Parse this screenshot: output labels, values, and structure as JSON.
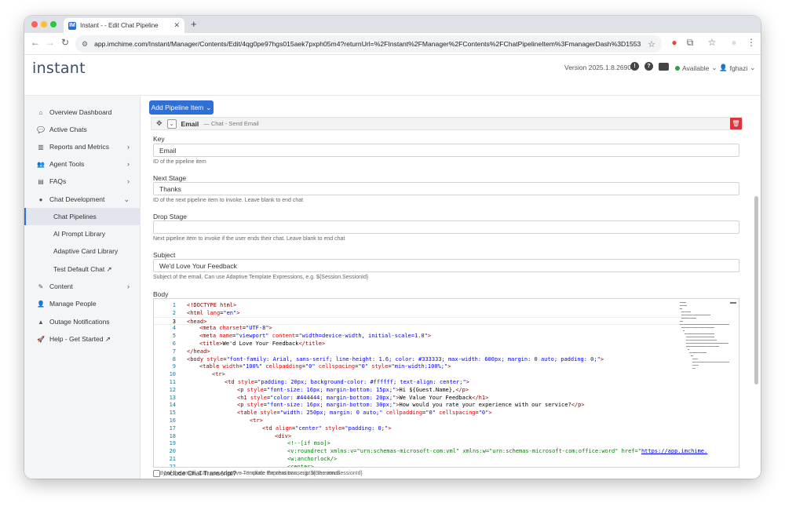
{
  "browser": {
    "tab_title": "Instant - - Edit Chat Pipeline",
    "favicon_text": "IM",
    "url": "app.imchime.com/Instant/Manager/Contents/Edit/4qg0pe97hgs015aek7pxph05m4?returnUrl=%2FInstant%2FManager%2FContents%2FChatPipelineItem%3FmanagerDash%3D1553283004"
  },
  "header": {
    "logo": "instant",
    "version": "Version 2025.1.8.2690",
    "status": "Available",
    "username": "fghazi"
  },
  "sidebar": {
    "items": [
      {
        "label": "Overview Dashboard",
        "icon": "home-icon",
        "glyph": "⌂"
      },
      {
        "label": "Active Chats",
        "icon": "chats-icon",
        "glyph": "💬"
      },
      {
        "label": "Reports and Metrics",
        "icon": "chart-icon",
        "glyph": "▥"
      },
      {
        "label": "Agent Tools",
        "icon": "users-icon",
        "glyph": "👥"
      },
      {
        "label": "FAQs",
        "icon": "book-icon",
        "glyph": "▤"
      },
      {
        "label": "Chat Development",
        "icon": "comment-icon",
        "glyph": "●"
      },
      {
        "label": "Chat Pipelines"
      },
      {
        "label": "AI Prompt Library"
      },
      {
        "label": "Adaptive Card Library"
      },
      {
        "label": "Test Default Chat ↗"
      },
      {
        "label": "Content",
        "icon": "edit-icon",
        "glyph": "✎"
      },
      {
        "label": "Manage People",
        "icon": "person-icon",
        "glyph": "👤"
      },
      {
        "label": "Outage Notifications",
        "icon": "warning-icon",
        "glyph": "▲"
      },
      {
        "label": "Help - Get Started ↗",
        "icon": "rocket-icon",
        "glyph": "🚀"
      }
    ],
    "collapse": "«"
  },
  "main": {
    "add_button": "Add Pipeline Item",
    "item_title": "Email",
    "item_subtitle": "— Chat - Send Email",
    "fields": {
      "key": {
        "label": "Key",
        "value": "Email",
        "help": "ID of the pipeline item"
      },
      "next_stage": {
        "label": "Next Stage",
        "value": "Thanks",
        "help": "ID of the next pipeline item to invoke. Leave blank to end chat"
      },
      "drop_stage": {
        "label": "Drop Stage",
        "value": "",
        "help": "Next pipeline item to invoke if the user ends their chat. Leave blank to end chat"
      },
      "subject": {
        "label": "Subject",
        "value": "We'd Love Your Feedback",
        "help": "Subject of the email. Can use Adaptive Template Expressions, e.g. ${Session.SessionId}"
      },
      "body": {
        "label": "Body",
        "help": "Body of the email. Can use Adaptive Template Expressions, e.g. ${Session.SessionId}"
      }
    },
    "code_lines": [
      {
        "n": "1",
        "indent": 0,
        "segs": [
          [
            "t",
            "<!DOCTYPE html>"
          ]
        ]
      },
      {
        "n": "2",
        "indent": 0,
        "segs": [
          [
            "t",
            "<html "
          ],
          [
            "a",
            "lang"
          ],
          [
            "x",
            "="
          ],
          [
            "v",
            "\"en\""
          ],
          [
            "t",
            ">"
          ]
        ]
      },
      {
        "n": "3",
        "indent": 0,
        "segs": [
          [
            "t",
            "<head>"
          ]
        ]
      },
      {
        "n": "4",
        "indent": 1,
        "segs": [
          [
            "t",
            "<meta "
          ],
          [
            "a",
            "charset"
          ],
          [
            "x",
            "="
          ],
          [
            "v",
            "\"UTF-8\""
          ],
          [
            "t",
            ">"
          ]
        ]
      },
      {
        "n": "5",
        "indent": 1,
        "segs": [
          [
            "t",
            "<meta "
          ],
          [
            "a",
            "name"
          ],
          [
            "x",
            "="
          ],
          [
            "v",
            "\"viewport\""
          ],
          [
            "x",
            " "
          ],
          [
            "a",
            "content"
          ],
          [
            "x",
            "="
          ],
          [
            "v",
            "\"width=device-width, initial-scale=1.0\""
          ],
          [
            "t",
            ">"
          ]
        ]
      },
      {
        "n": "6",
        "indent": 1,
        "segs": [
          [
            "t",
            "<title>"
          ],
          [
            "x",
            "We'd Love Your Feedback"
          ],
          [
            "t",
            "</title>"
          ]
        ]
      },
      {
        "n": "7",
        "indent": 0,
        "segs": [
          [
            "t",
            "</head>"
          ]
        ]
      },
      {
        "n": "8",
        "indent": 0,
        "segs": [
          [
            "t",
            "<body "
          ],
          [
            "a",
            "style"
          ],
          [
            "x",
            "="
          ],
          [
            "v",
            "\"font-family: Arial, sans-serif; line-height: 1.6; color: #333333; max-width: 600px; margin: 0 auto; padding: 0;\""
          ],
          [
            "t",
            ">"
          ]
        ]
      },
      {
        "n": "9",
        "indent": 1,
        "segs": [
          [
            "t",
            "<table "
          ],
          [
            "a",
            "width"
          ],
          [
            "x",
            "="
          ],
          [
            "v",
            "\"100%\""
          ],
          [
            "x",
            " "
          ],
          [
            "a",
            "cellpadding"
          ],
          [
            "x",
            "="
          ],
          [
            "v",
            "\"0\""
          ],
          [
            "x",
            " "
          ],
          [
            "a",
            "cellspacing"
          ],
          [
            "x",
            "="
          ],
          [
            "v",
            "\"0\""
          ],
          [
            "x",
            " "
          ],
          [
            "a",
            "style"
          ],
          [
            "x",
            "="
          ],
          [
            "v",
            "\"min-width:100%;\""
          ],
          [
            "t",
            ">"
          ]
        ]
      },
      {
        "n": "10",
        "indent": 2,
        "segs": [
          [
            "t",
            "<tr>"
          ]
        ]
      },
      {
        "n": "11",
        "indent": 3,
        "segs": [
          [
            "t",
            "<td "
          ],
          [
            "a",
            "style"
          ],
          [
            "x",
            "="
          ],
          [
            "v",
            "\"padding: 20px; background-color: #ffffff; text-align: center;\""
          ],
          [
            "t",
            ">"
          ]
        ]
      },
      {
        "n": "12",
        "indent": 4,
        "segs": [
          [
            "t",
            "<p "
          ],
          [
            "a",
            "style"
          ],
          [
            "x",
            "="
          ],
          [
            "v",
            "\"font-size: 16px; margin-bottom: 15px;\""
          ],
          [
            "t",
            ">"
          ],
          [
            "x",
            "Hi ${Guest.Name},"
          ],
          [
            "t",
            "</p>"
          ]
        ]
      },
      {
        "n": "13",
        "indent": 4,
        "segs": [
          [
            "t",
            "<h1 "
          ],
          [
            "a",
            "style"
          ],
          [
            "x",
            "="
          ],
          [
            "v",
            "\"color: #444444; margin-bottom: 20px;\""
          ],
          [
            "t",
            ">"
          ],
          [
            "x",
            "We Value Your Feedback"
          ],
          [
            "t",
            "</h1>"
          ]
        ]
      },
      {
        "n": "14",
        "indent": 4,
        "segs": [
          [
            "t",
            "<p "
          ],
          [
            "a",
            "style"
          ],
          [
            "x",
            "="
          ],
          [
            "v",
            "\"font-size: 16px; margin-bottom: 30px;\""
          ],
          [
            "t",
            ">"
          ],
          [
            "x",
            "How would you rate your experience with our service?"
          ],
          [
            "t",
            "</p>"
          ]
        ]
      },
      {
        "n": "15",
        "indent": 4,
        "segs": [
          [
            "t",
            "<table "
          ],
          [
            "a",
            "style"
          ],
          [
            "x",
            "="
          ],
          [
            "v",
            "\"width: 250px; margin: 0 auto;\""
          ],
          [
            "x",
            " "
          ],
          [
            "a",
            "cellpadding"
          ],
          [
            "x",
            "="
          ],
          [
            "v",
            "\"0\""
          ],
          [
            "x",
            " "
          ],
          [
            "a",
            "cellspacing"
          ],
          [
            "x",
            "="
          ],
          [
            "v",
            "\"0\""
          ],
          [
            "t",
            ">"
          ]
        ]
      },
      {
        "n": "16",
        "indent": 5,
        "segs": [
          [
            "t",
            "<tr>"
          ]
        ]
      },
      {
        "n": "17",
        "indent": 6,
        "segs": [
          [
            "t",
            "<td "
          ],
          [
            "a",
            "align"
          ],
          [
            "x",
            "="
          ],
          [
            "v",
            "\"center\""
          ],
          [
            "x",
            " "
          ],
          [
            "a",
            "style"
          ],
          [
            "x",
            "="
          ],
          [
            "v",
            "\"padding: 0;\""
          ],
          [
            "t",
            ">"
          ]
        ]
      },
      {
        "n": "18",
        "indent": 7,
        "segs": [
          [
            "t",
            "<div>"
          ]
        ]
      },
      {
        "n": "19",
        "indent": 8,
        "segs": [
          [
            "c",
            "<!--[if mso]>"
          ]
        ]
      },
      {
        "n": "20",
        "indent": 8,
        "segs": [
          [
            "c",
            "<v:roundrect xmlns:v=\"urn:schemas-microsoft-com:vml\" xmlns:w=\"urn:schemas-microsoft-com:office:word\" href=\""
          ],
          [
            "u",
            "https://app.imchime."
          ]
        ]
      },
      {
        "n": "21",
        "indent": 8,
        "segs": [
          [
            "c",
            "<w:anchorlock/>"
          ]
        ]
      },
      {
        "n": "22",
        "indent": 8,
        "segs": [
          [
            "c",
            "<center>"
          ]
        ]
      }
    ],
    "checkbox": {
      "label": "Include Chat Transcript?",
      "hint": "— Include the chat transcript in the email",
      "checked": false
    }
  }
}
